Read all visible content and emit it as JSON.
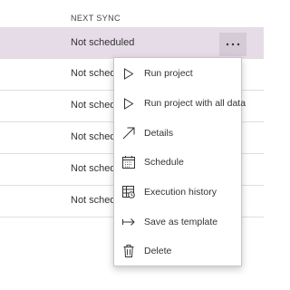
{
  "table": {
    "column_header": "NEXT SYNC",
    "rows": [
      {
        "next_sync": "Not scheduled"
      },
      {
        "next_sync": "Not scheduled"
      },
      {
        "next_sync": "Not scheduled"
      },
      {
        "next_sync": "Not scheduled"
      },
      {
        "next_sync": "Not scheduled"
      },
      {
        "next_sync": "Not scheduled"
      }
    ]
  },
  "more_button": {
    "icon": "ellipsis-icon"
  },
  "context_menu": {
    "items": [
      {
        "label": "Run project",
        "icon": "play-icon"
      },
      {
        "label": "Run project with all data",
        "icon": "play-icon"
      },
      {
        "label": "Details",
        "icon": "arrow-diagonal-icon"
      },
      {
        "label": "Schedule",
        "icon": "calendar-icon"
      },
      {
        "label": "Execution history",
        "icon": "history-table-icon"
      },
      {
        "label": "Save as template",
        "icon": "arrow-to-bar-icon"
      },
      {
        "label": "Delete",
        "icon": "trash-icon"
      }
    ]
  },
  "colors": {
    "selected_row": "#e5dce7",
    "more_button_bg": "#d4cad8",
    "divider": "#e1dfdd"
  }
}
